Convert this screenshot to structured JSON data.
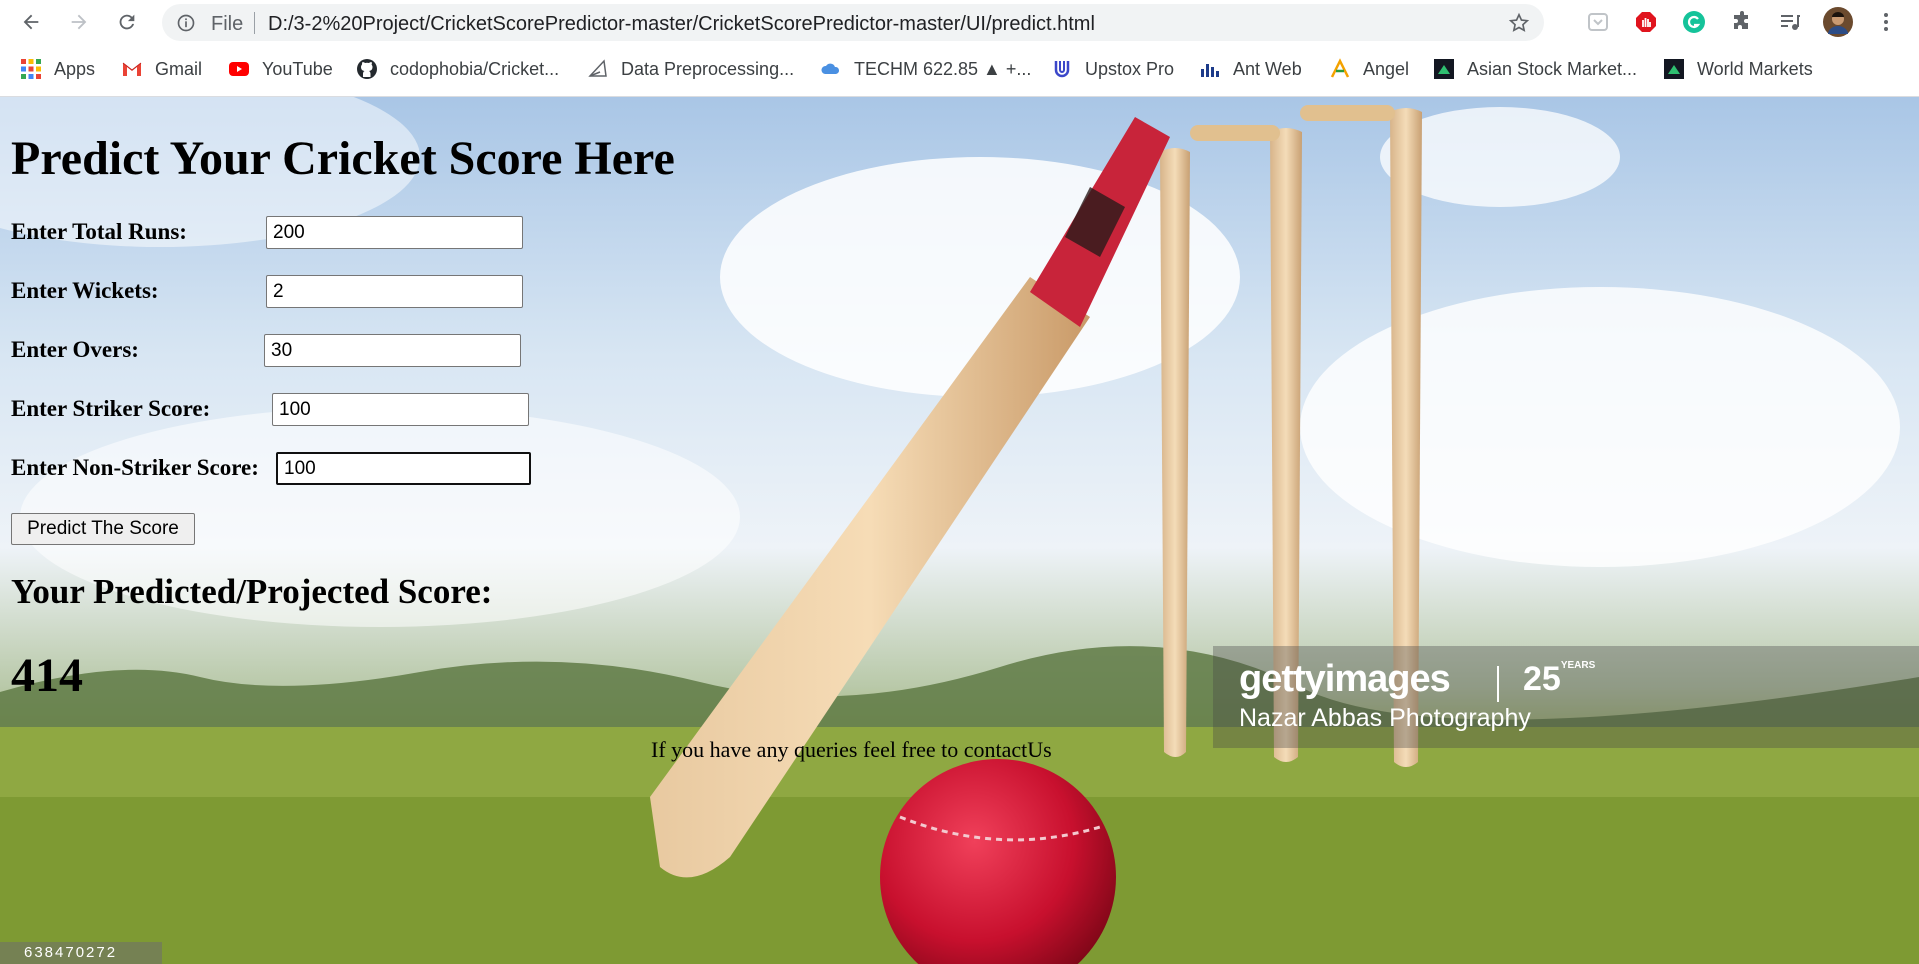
{
  "browser": {
    "omnibox": {
      "scheme_label": "File",
      "url": "D:/3-2%20Project/CricketScorePredictor-master/CricketScorePredictor-master/UI/predict.html"
    },
    "bookmarks": [
      {
        "label": "Apps",
        "icon": "apps-grid-icon"
      },
      {
        "label": "Gmail",
        "icon": "gmail-icon"
      },
      {
        "label": "YouTube",
        "icon": "youtube-icon"
      },
      {
        "label": "codophobia/Cricket...",
        "icon": "github-icon"
      },
      {
        "label": "Data Preprocessing...",
        "icon": "triangle-icon"
      },
      {
        "label": "TECHM 622.85 ▲ +...",
        "icon": "cloud-icon"
      },
      {
        "label": "Upstox Pro",
        "icon": "upstox-icon"
      },
      {
        "label": "Ant Web",
        "icon": "antweb-icon"
      },
      {
        "label": "Angel",
        "icon": "angel-icon"
      },
      {
        "label": "Asian Stock Market...",
        "icon": "tradingview-icon"
      },
      {
        "label": "World Markets",
        "icon": "tradingview-icon"
      }
    ]
  },
  "form": {
    "title": "Predict Your Cricket Score Here",
    "fields": [
      {
        "label": "Enter Total Runs:",
        "value": "200"
      },
      {
        "label": "Enter Wickets:",
        "value": "2"
      },
      {
        "label": "Enter Overs:",
        "value": "30"
      },
      {
        "label": "Enter Striker Score:",
        "value": "100"
      },
      {
        "label": "Enter Non-Striker Score:",
        "value": "100"
      }
    ],
    "button_label": "Predict The Score"
  },
  "result": {
    "heading": "Your Predicted/Projected Score:",
    "value": "414"
  },
  "footer": {
    "contact_text": "If you have any queries feel free to contactUs"
  },
  "watermark": {
    "brand": "gettyimages",
    "years": "25",
    "years_suffix": "YEARS",
    "credit": "Nazar Abbas Photography",
    "stock_id": "638470272"
  },
  "colors": {
    "sky": "#cfe0f0",
    "grass": "#8aa63d",
    "ball": "#d1102a",
    "bat_grip": "#c8243a"
  }
}
